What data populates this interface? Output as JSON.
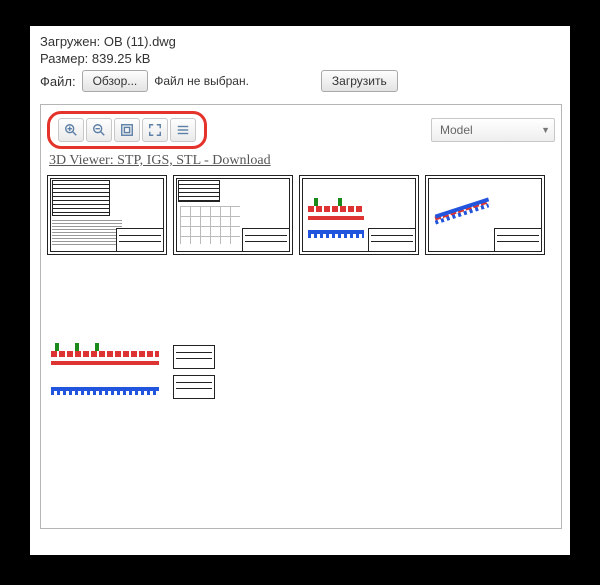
{
  "info": {
    "loaded_label": "Загружен:",
    "loaded_value": "ОВ (11).dwg",
    "size_label": "Размер:",
    "size_value": "839.25 kB"
  },
  "file_row": {
    "label": "Файл:",
    "browse_button": "Обзор...",
    "status_text": "Файл не выбран.",
    "upload_button": "Загрузить"
  },
  "toolbar": {
    "zoom_in": "zoom-in",
    "zoom_out": "zoom-out",
    "fit_window": "fit-window",
    "fullscreen": "fullscreen",
    "layers": "layers"
  },
  "model_select": {
    "value": "Model"
  },
  "viewer_link": "3D Viewer: STP, IGS, STL - Download"
}
